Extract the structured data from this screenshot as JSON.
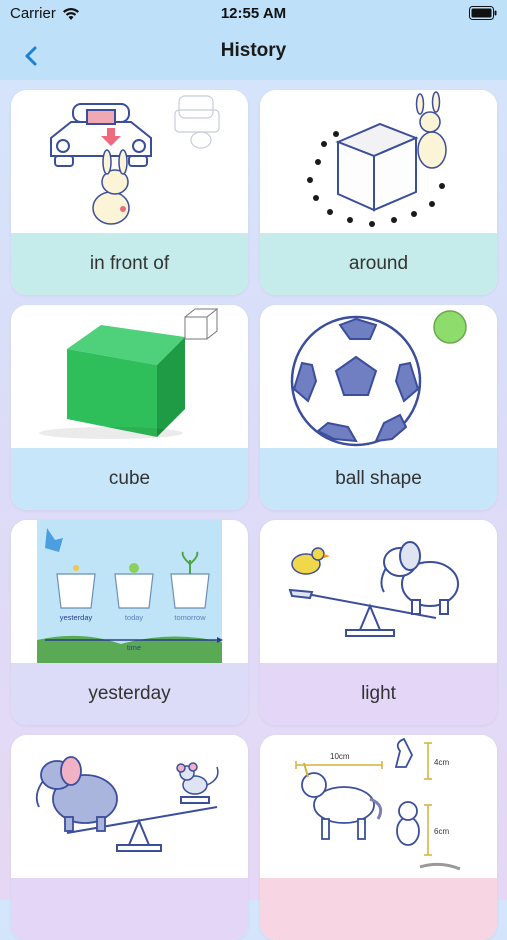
{
  "status_bar": {
    "carrier": "Carrier",
    "time": "12:55 AM"
  },
  "nav": {
    "title": "History"
  },
  "colors": {
    "header": "#bfe0f9",
    "label_teal": "#c5ecea",
    "label_sky": "#c8e6f9",
    "label_lavender": "#dcdcf8",
    "label_lilac": "#e3d6f6",
    "label_pink": "#f8d5e2"
  },
  "items": [
    {
      "label": "in front of",
      "icon": "bunny-car-illustration"
    },
    {
      "label": "around",
      "icon": "box-pawprints-illustration"
    },
    {
      "label": "cube",
      "icon": "green-cube-illustration"
    },
    {
      "label": "ball shape",
      "icon": "soccer-ball-illustration"
    },
    {
      "label": "yesterday",
      "icon": "plant-pots-illustration",
      "image_text": {
        "pot1": "yesterday",
        "pot2": "today",
        "pot3": "tomorrow",
        "axis": "time"
      }
    },
    {
      "label": "light",
      "icon": "bird-elephant-seesaw-illustration"
    },
    {
      "label": "",
      "icon": "elephant-mouse-seesaw-illustration"
    },
    {
      "label": "",
      "icon": "unicorn-measure-illustration",
      "image_text": {
        "m1": "10cm",
        "m2": "4cm",
        "m3": "6cm"
      }
    }
  ]
}
